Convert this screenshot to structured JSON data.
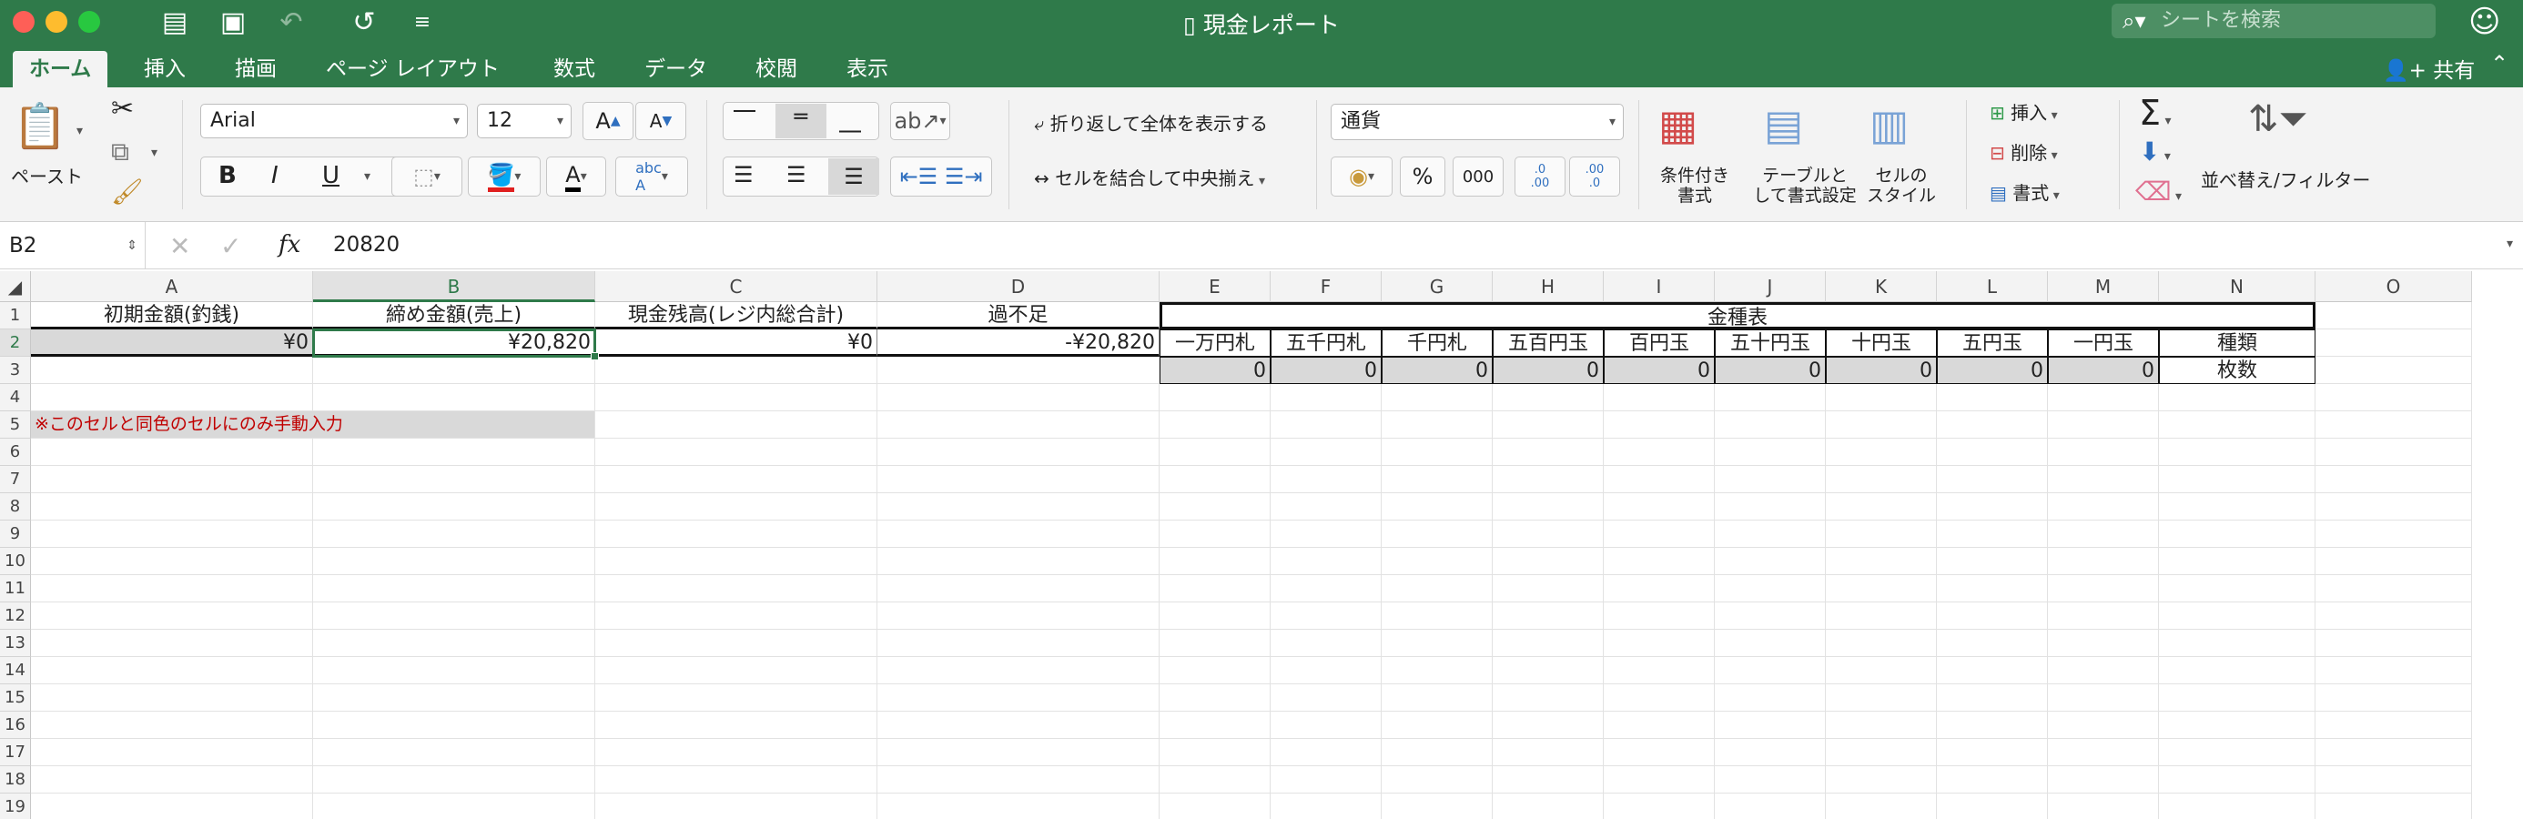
{
  "window": {
    "title": "現金レポート",
    "search_placeholder": "シートを検索"
  },
  "tabs": [
    "ホーム",
    "挿入",
    "描画",
    "ページ レイアウト",
    "数式",
    "データ",
    "校閲",
    "表示"
  ],
  "share_label": "共有",
  "ribbon": {
    "paste_label": "ペースト",
    "font_name": "Arial",
    "font_size": "12",
    "bold": "B",
    "italic": "I",
    "underline": "U",
    "wrap_text": "折り返して全体を表示する",
    "merge_center": "セルを結合して中央揃え",
    "number_format": "通貨",
    "percent": "%",
    "comma": "000",
    "cond_format_1": "条件付き",
    "cond_format_2": "書式",
    "table_format_1": "テーブルと",
    "table_format_2": "して書式設定",
    "cell_style_1": "セルの",
    "cell_style_2": "スタイル",
    "insert": "挿入",
    "delete": "削除",
    "format": "書式",
    "sort_filter": "並べ替え/フィルター",
    "dec_inc": ".0\n.00",
    "dec_dec": ".00\n.0"
  },
  "formula_bar": {
    "name_box": "B2",
    "fx": "fx",
    "value": "20820"
  },
  "columns": [
    "A",
    "B",
    "C",
    "D",
    "E",
    "F",
    "G",
    "H",
    "I",
    "J",
    "K",
    "L",
    "M",
    "N",
    "O"
  ],
  "rows": [
    "1",
    "2",
    "3",
    "4",
    "5",
    "6",
    "7",
    "8",
    "9",
    "10",
    "11",
    "12",
    "13",
    "14",
    "15",
    "16",
    "17",
    "18",
    "19"
  ],
  "cells": {
    "A1": "初期金額(釣銭)",
    "B1": "締め金額(売上)",
    "C1": "現金残高(レジ内総合計)",
    "D1": "過不足",
    "J1": "金種表",
    "A2": "¥0",
    "B2": "¥20,820",
    "C2": "¥0",
    "D2": "-¥20,820",
    "E2": "一万円札",
    "F2": "五千円札",
    "G2": "千円札",
    "H2": "五百円玉",
    "I2": "百円玉",
    "J2": "五十円玉",
    "K2": "十円玉",
    "L2": "五円玉",
    "M2": "一円玉",
    "N2": "種類",
    "E3": "0",
    "F3": "0",
    "G3": "0",
    "H3": "0",
    "I3": "0",
    "J3": "0",
    "K3": "0",
    "L3": "0",
    "M3": "0",
    "N3": "枚数",
    "A5": "※このセルと同色のセルにのみ手動入力"
  },
  "colors": {
    "excel_green": "#2f7a4a",
    "input_gray": "#d9d9d9",
    "note_red": "#c00000"
  }
}
